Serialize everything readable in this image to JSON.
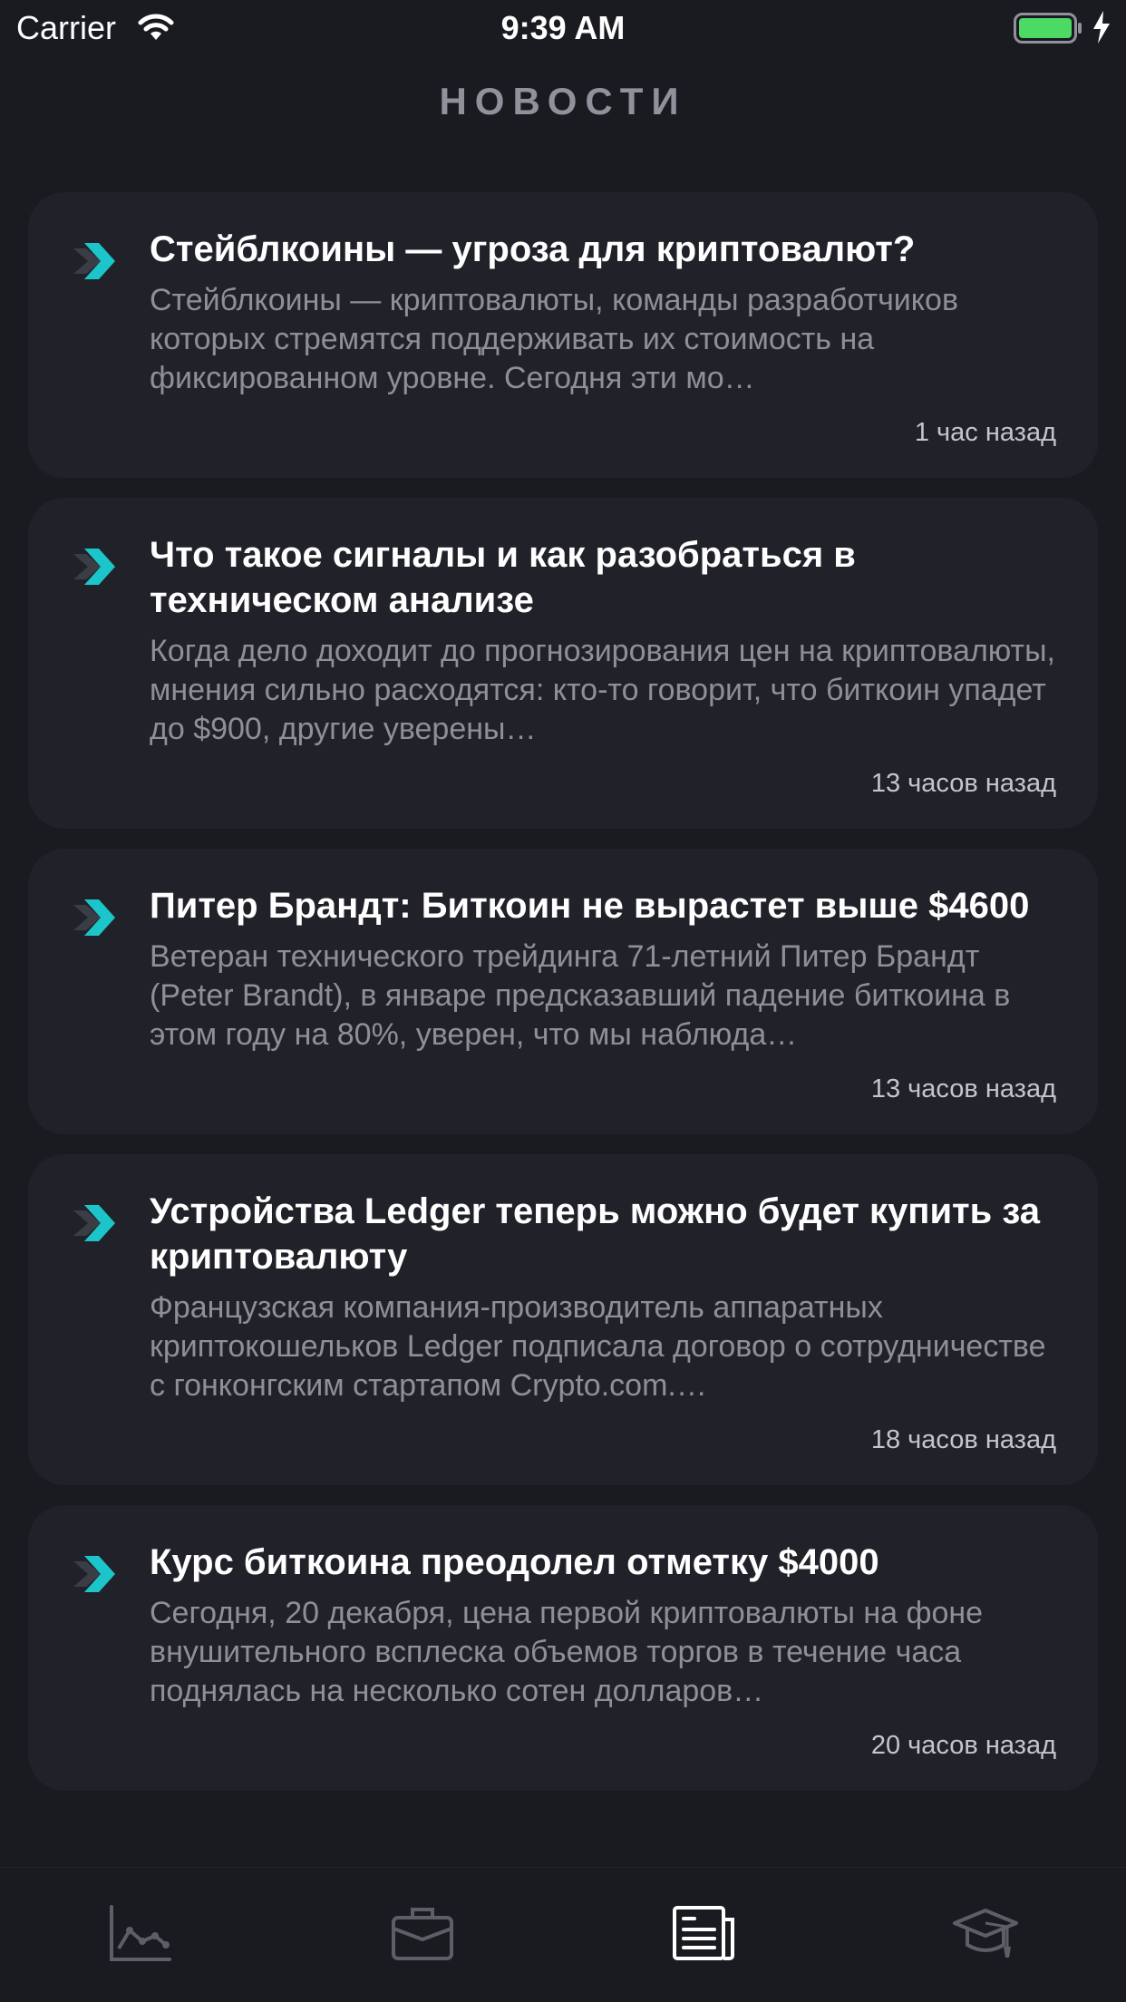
{
  "status_bar": {
    "carrier": "Carrier",
    "time": "9:39 AM",
    "battery_color": "#4cd964"
  },
  "header": {
    "title": "НОВОСТИ"
  },
  "accent_color": "#1cc5c9",
  "news": [
    {
      "title": "Стейблкоины — угроза для криптовалют?",
      "text": "Стейблкоины — криптовалюты, команды разработчиков которых стремятся поддерживать их стоимость на фиксированном уровне. Сегодня эти мо…",
      "time": "1 час назад"
    },
    {
      "title": "Что такое сигналы и как разобраться в техническом анализе",
      "text": "Когда дело доходит до прогнозирования цен на криптовалюты, мнения сильно расходятся: кто-то говорит, что биткоин упадет до $900, другие уверены…",
      "time": "13 часов назад"
    },
    {
      "title": "Питер Брандт: Биткоин не вырастет выше $4600",
      "text": "Ветеран технического трейдинга 71-летний Питер Брандт (Peter Brandt), в январе предсказавший падение биткоина в этом году на 80%, уверен, что мы наблюда…",
      "time": "13 часов назад"
    },
    {
      "title": "Устройства Ledger теперь можно будет купить за криптовалюту",
      "text": "Французская компания-производитель аппаратных криптокошельков Ledger подписала договор о сотрудничестве с гонконгским стартапом Crypto.com.…",
      "time": "18 часов назад"
    },
    {
      "title": "Курс биткоина преодолел отметку $4000",
      "text": "Сегодня, 20 декабря, цена первой криптовалюты на фоне внушительного всплеска объемов торгов в течение часа поднялась на несколько сотен долларов…",
      "time": "20 часов назад"
    }
  ],
  "tab_bar": {
    "tabs": [
      {
        "icon": "chart-icon",
        "active": false
      },
      {
        "icon": "briefcase-icon",
        "active": false
      },
      {
        "icon": "news-icon",
        "active": true
      },
      {
        "icon": "graduation-cap-icon",
        "active": false
      }
    ]
  }
}
